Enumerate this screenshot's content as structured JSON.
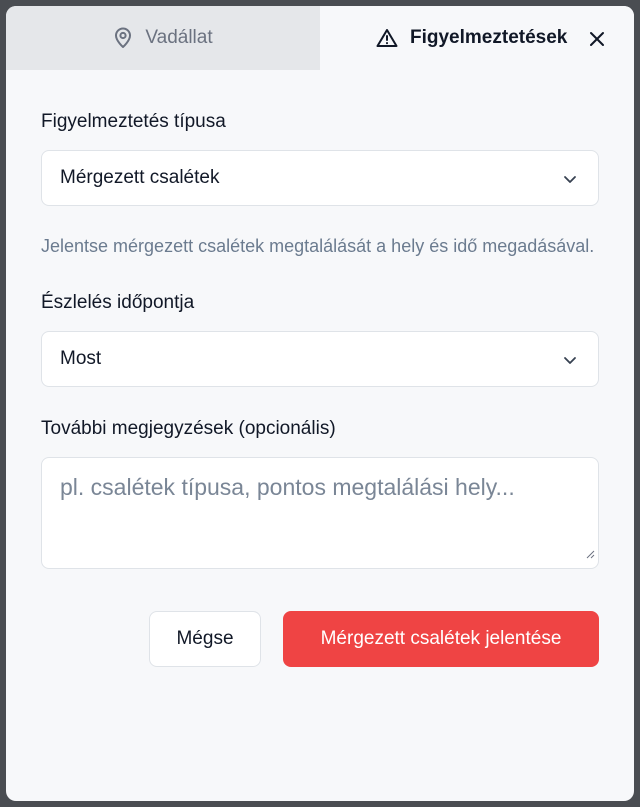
{
  "tabs": [
    {
      "label": "Vadállat",
      "icon": "map-pin-icon"
    },
    {
      "label": "Figyelmeztetések",
      "icon": "warning-icon"
    }
  ],
  "form": {
    "alert_type_label": "Figyelmeztetés típusa",
    "alert_type_value": "Mérgezett csalétek",
    "help_text": "Jelentse mérgezett csalétek megtalálását a hely és idő megadásával.",
    "time_label": "Észlelés időpontja",
    "time_value": "Most",
    "notes_label": "További megjegyzések (opcionális)",
    "notes_placeholder": "pl. csalétek típusa, pontos megtalálási hely..."
  },
  "actions": {
    "cancel_label": "Mégse",
    "submit_label": "Mérgezett csalétek jelentése"
  },
  "colors": {
    "primary": "#ef4444",
    "inactive_tab": "#e5e7ea",
    "help_text": "#6b7b8f"
  }
}
